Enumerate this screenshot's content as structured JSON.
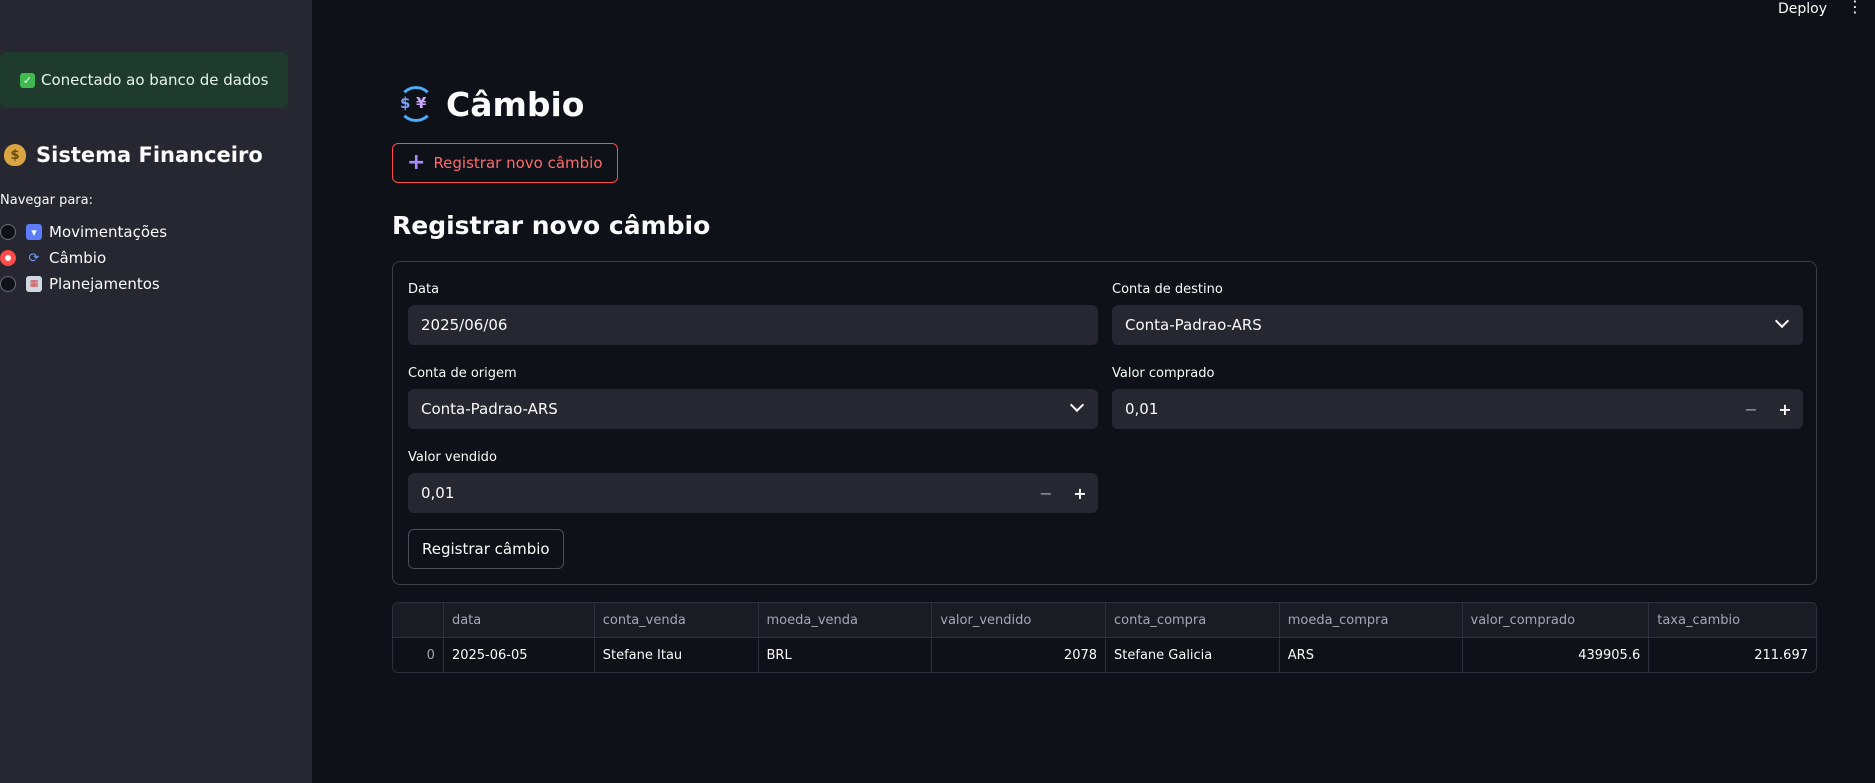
{
  "header": {
    "deploy_label": "Deploy"
  },
  "sidebar": {
    "status_message": "Conectado ao banco de dados",
    "title": "Sistema Financeiro",
    "nav_label": "Navegar para:",
    "items": [
      {
        "label": "Movimentações",
        "icon": "inbox-tray-icon",
        "selected": false
      },
      {
        "label": "Câmbio",
        "icon": "currency-exchange-icon",
        "selected": true
      },
      {
        "label": "Planejamentos",
        "icon": "calendar-icon",
        "selected": false
      }
    ]
  },
  "main": {
    "title": "Câmbio",
    "new_button": "Registrar novo câmbio",
    "section_title": "Registrar novo câmbio",
    "form": {
      "data_label": "Data",
      "data_value": "2025/06/06",
      "conta_destino_label": "Conta de destino",
      "conta_destino_value": "Conta-Padrao-ARS",
      "conta_origem_label": "Conta de origem",
      "conta_origem_value": "Conta-Padrao-ARS",
      "valor_comprado_label": "Valor comprado",
      "valor_comprado_value": "0,01",
      "valor_vendido_label": "Valor vendido",
      "valor_vendido_value": "0,01",
      "minus": "−",
      "plus": "+",
      "submit": "Registrar câmbio"
    },
    "table": {
      "columns": [
        "",
        "data",
        "conta_venda",
        "moeda_venda",
        "valor_vendido",
        "conta_compra",
        "moeda_compra",
        "valor_comprado",
        "taxa_cambio"
      ],
      "rows": [
        [
          "0",
          "2025-06-05",
          "Stefane Itau",
          "BRL",
          "2078",
          "Stefane Galicia",
          "ARS",
          "439905.6",
          "211.697"
        ]
      ]
    }
  },
  "colors": {
    "accent": "#ff4b4b",
    "background": "#0e1117",
    "sidebar": "#262730",
    "success": "#1f3b2d"
  }
}
